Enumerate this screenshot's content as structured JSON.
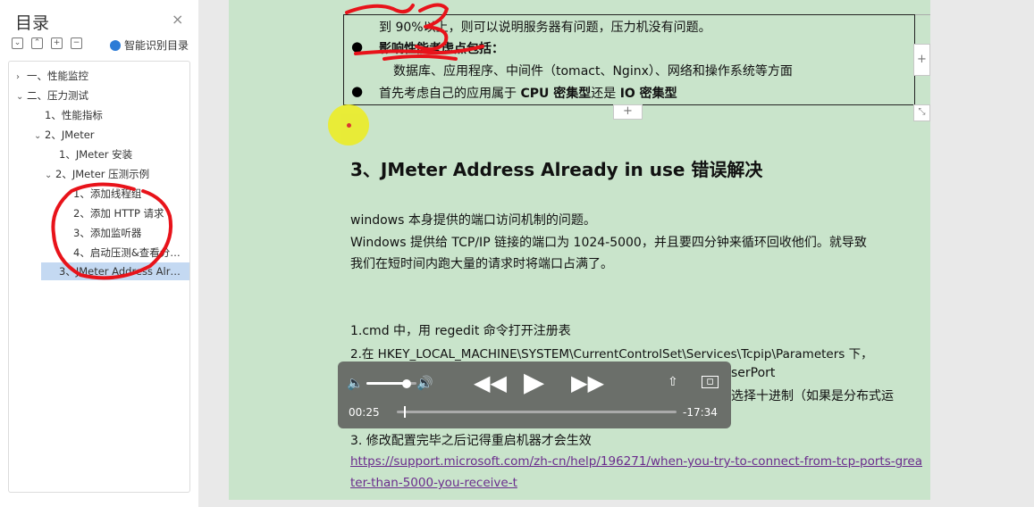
{
  "sidebar": {
    "title": "目录",
    "close": "×",
    "toolbar": {
      "collapse_all": "⌄",
      "expand_all": "⌃",
      "add": "+",
      "remove": "−",
      "smart_label": "智能识别目录"
    },
    "items": [
      {
        "arrow": "›",
        "label": "一、性能监控"
      },
      {
        "arrow": "⌄",
        "label": "二、压力测试"
      },
      {
        "arrow": "",
        "label": "1、性能指标"
      },
      {
        "arrow": "⌄",
        "label": "2、JMeter"
      },
      {
        "arrow": "",
        "label": "1、JMeter 安装"
      },
      {
        "arrow": "⌄",
        "label": "2、JMeter 压测示例"
      },
      {
        "arrow": "",
        "label": "1、添加线程组"
      },
      {
        "arrow": "",
        "label": "2、添加 HTTP 请求"
      },
      {
        "arrow": "",
        "label": "3、添加监听器"
      },
      {
        "arrow": "",
        "label": "4、启动压测&查看分…"
      },
      {
        "arrow": "",
        "label": "3、JMeter Address Alr…"
      }
    ]
  },
  "doc": {
    "line1": "到 90%以上，则可以说明服务器有问题，压力机没有问题。",
    "bullet1_label": "影响性能考虑点包括：",
    "line3": "数据库、应用程序、中间件（tomact、Nginx）、网络和操作系统等方面",
    "bullet2_pre": "首先考虑自己的应用属于 ",
    "bullet2_b1": "CPU 密集型",
    "bullet2_mid": "还是 ",
    "bullet2_b2": "IO 密集型",
    "bullet_glyph": "●",
    "heading": "3、JMeter Address Already in use 错误解决",
    "para1": "windows 本身提供的端口访问机制的问题。",
    "para2a": "Windows 提供给  TCP/IP 链接的端口为  1024-5000，并且要四分钟来循环回收他们。就导致",
    "para2b": "我们在短时间内跑大量的请求时将端口占满了。",
    "step1": "1.cmd 中，用 regedit 命令打开注册表",
    "step2": "2.在  HKEY_LOCAL_MACHINE\\SYSTEM\\CurrentControlSet\\Services\\Tcpip\\Parameters 下，",
    "step2_hidden_tail": "serPort",
    "step2_hidden_tail2": "选择十进制（如果是分布式运",
    "step3": "3.  修改配置完毕之后记得重启机器才会生效",
    "link1": "https://support.microsoft.com/zh-cn/help/196271/when-you-try-to-connect-from-tcp-ports-grea",
    "link2": "ter-than-5000-you-receive-t"
  },
  "player": {
    "elapsed": "00:25",
    "remaining": "-17:34",
    "volume": 0.8,
    "progress": 0.024
  },
  "colors": {
    "page": "#c9e4cb",
    "player": "#6b6f6a",
    "scribble": "#e8131a",
    "link": "#6a2b8c",
    "selection": "#c4d9f2"
  }
}
